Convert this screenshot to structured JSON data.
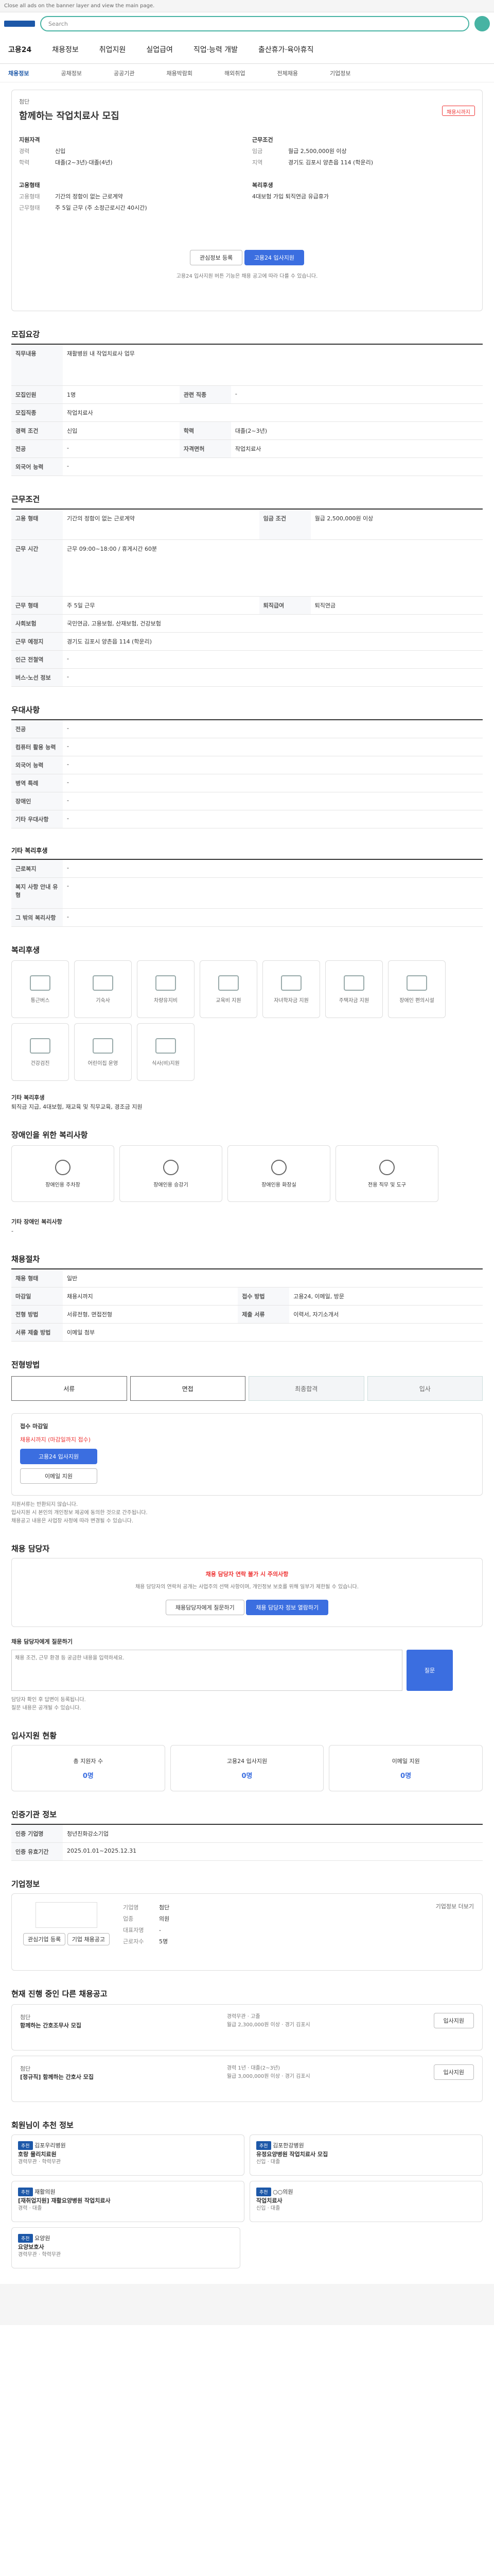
{
  "top": {
    "notice": "Close all ads on the banner layer and view the main page.",
    "search_placeholder": "Search"
  },
  "gnb": {
    "logo": "고용24",
    "menu": [
      "채용정보",
      "취업지원",
      "실업급여",
      "직업·능력 개발",
      "출산휴가·육아휴직"
    ]
  },
  "subnav": [
    "채용정보",
    "공채정보",
    "공공기관",
    "채용박람회",
    "해외취업",
    "전체채용",
    "기업정보"
  ],
  "job": {
    "company": "첨단",
    "title": "함께하는 작업치료사 모집",
    "badge": "채용시까지",
    "reqs": [
      [
        "지원자격",
        ""
      ],
      [
        "경력",
        "신입"
      ],
      [
        "학력",
        "대졸(2~3년)·대졸(4년)"
      ]
    ],
    "conds": [
      [
        "근무조건",
        ""
      ],
      [
        "임금",
        "월급 2,500,000원 이상"
      ],
      [
        "지역",
        "경기도 김포시 양촌읍 114 (학운리)"
      ]
    ],
    "env": [
      [
        "고용형태",
        ""
      ],
      [
        "고용형태",
        "기간의 정함이 없는 근로계약"
      ],
      [
        "근무형태",
        "주 5일 근무 (주 소정근로시간 40시간)"
      ]
    ],
    "benefit": [
      [
        "복리후생",
        ""
      ],
      [
        "",
        "4대보험 가입   퇴직연금   유급휴가"
      ]
    ],
    "scrap": "관심정보 등록",
    "apply": "고용24 입사지원",
    "notice": "고용24 입사지원 버튼 기능은 채용 공고에 따라 다를 수 있습니다."
  },
  "s1": {
    "title": "모집요강",
    "rows": [
      [
        "직무내용",
        "재활병원 내 작업치료사 업무"
      ],
      [
        "모집직종",
        "작업치료사"
      ],
      [
        "관련 직종",
        "-"
      ],
      [
        "모집인원",
        "1명"
      ],
      [
        "경력 조건",
        "신입"
      ],
      [
        "학력",
        "대졸(2~3년)"
      ],
      [
        "전공",
        "-"
      ],
      [
        "자격면허",
        "작업치료사"
      ],
      [
        "외국어 능력",
        "-"
      ]
    ]
  },
  "s2": {
    "title": "근무조건",
    "rows": [
      [
        "고용 형태",
        "기간의 정함이 없는 근로계약"
      ],
      [
        "임금 조건",
        "월급 2,500,000원 이상"
      ],
      [
        "근무 시간",
        "근무 09:00~18:00 / 휴게시간 60분"
      ],
      [
        "근무 형태",
        "주 5일 근무"
      ],
      [
        "사회보험",
        "국민연금, 고용보험, 산재보험, 건강보험"
      ],
      [
        "퇴직급여",
        "퇴직연금"
      ],
      [
        "근무 예정지",
        "경기도 김포시 양촌읍 114 (학운리)"
      ],
      [
        "인근 전철역",
        "-"
      ],
      [
        "버스·노선 정보",
        "-"
      ]
    ]
  },
  "s3": {
    "title": "우대사항",
    "rows": [
      [
        "전공",
        "-"
      ],
      [
        "컴퓨터 활용 능력",
        "-"
      ],
      [
        "외국어 능력",
        "-"
      ],
      [
        "병역 특례",
        "-"
      ],
      [
        "장애인",
        "-"
      ],
      [
        "기타 우대사항",
        "-"
      ]
    ],
    "sub_title": "기타 복리후생",
    "rows2": [
      [
        "근로복지",
        "-"
      ],
      [
        "복지 사항 안내 유형",
        "-"
      ],
      [
        "그 밖의 복리사항",
        "-"
      ]
    ]
  },
  "s4": {
    "title": "복리후생",
    "items": [
      "통근버스",
      "기숙사",
      "차량유지비",
      "교육비 지원",
      "자녀학자금 지원",
      "주택자금 지원",
      "장애인 편의시설",
      "건강검진",
      "어린이집 운영",
      "식사(비)지원"
    ],
    "other_title": "기타 복리후생",
    "other": "퇴직금 지급, 4대보험, 재교육 및 직무교육, 경조금 지원"
  },
  "s5": {
    "title": "장애인을 위한 복리사항",
    "items": [
      "장애인용 주차장",
      "장애인용 승강기",
      "장애인용 화장실",
      "전용 직무 및 도구"
    ],
    "other_title": "기타 장애인 복리사항",
    "other": "-"
  },
  "s6": {
    "title": "채용절차",
    "rows": [
      [
        "채용 형태",
        "일반"
      ],
      [
        "마감일",
        "채용시까지"
      ],
      [
        "접수 방법",
        "고용24, 이메일, 방문"
      ],
      [
        "전형 방법",
        "서류전형, 면접전형"
      ],
      [
        "제출 서류",
        "이력서, 자기소개서"
      ],
      [
        "서류 제출 방법",
        "이메일 첨부"
      ]
    ]
  },
  "s7": {
    "title": "전형방법",
    "steps": [
      "서류",
      "면접",
      "최종합격",
      "입사"
    ],
    "doc_title": "접수 마감일",
    "doc": "채용시까지 (마감일까지 접수)",
    "apply": "고용24 입사지원",
    "email": "이메일 지원",
    "notes": [
      "지원서류는 반환되지 않습니다.",
      "입사지원 시 본인의 개인정보 제공에 동의한 것으로 간주됩니다.",
      "채용공고 내용은 사업장 사정에 따라 변경될 수 있습니다."
    ]
  },
  "s8": {
    "title": "채용 담당자",
    "warn": "채용 담당자 연락 불가 시 주의사항",
    "warn_text": "채용 담당자의 연락처 공개는 사업주의 선택 사항이며, 개인정보 보호를 위해 일부가 제한될 수 있습니다.",
    "b1": "채용담당자에게 질문하기",
    "b2": "채용 담당자 정보 열람하기",
    "qa_title": "채용 담당자에게 질문하기",
    "qa_placeholder": "채용 조건, 근무 환경 등 궁금한 내용을 입력하세요.",
    "qa_btn": "질문",
    "notes": [
      "담당자 확인 후 답변이 등록됩니다.",
      "질문 내용은 공개될 수 있습니다."
    ]
  },
  "s9": {
    "title": "입사지원 현황",
    "stats": [
      [
        "총 지원자 수",
        "0명"
      ],
      [
        "고용24 입사지원",
        "0명"
      ],
      [
        "이메일 지원",
        "0명"
      ]
    ]
  },
  "s10": {
    "title": "인증기관 정보",
    "rows": [
      [
        "인증 기업명",
        "청년친화강소기업"
      ],
      [
        "인증 유효기간",
        "2025.01.01~2025.12.31"
      ]
    ]
  },
  "s11": {
    "title": "기업정보",
    "company": "첨단",
    "info": [
      [
        "기업명",
        "첨단"
      ],
      [
        "업종",
        "의원"
      ],
      [
        "대표자명",
        "-"
      ],
      [
        "근로자수",
        "5명"
      ]
    ],
    "more": "기업정보 더보기",
    "b1": "관심기업 등록",
    "b2": "기업 채용공고"
  },
  "s12": {
    "title": "현재 진행 중인 다른 채용공고",
    "jobs": [
      {
        "company": "첨단",
        "title": "함께하는 간호조무사 모집",
        "c1": "경력무관",
        "c2": "고졸",
        "c3": "월급 2,300,000원 이상",
        "c4": "경기 김포시"
      },
      {
        "company": "첨단",
        "title": "[정규직] 함께하는 간호사 모집",
        "c1": "경력 1년",
        "c2": "대졸(2~3년)",
        "c3": "월급 3,000,000원 이상",
        "c4": "경기 김포시"
      }
    ],
    "btn": "입사지원"
  },
  "s13": {
    "title": "회원님이 추천 정보",
    "recs": [
      {
        "tag": "추천",
        "company": "김포우리병원",
        "title": "호랑 물리치료원",
        "sub": "경력무관 · 학력무관"
      },
      {
        "tag": "추천",
        "company": "김포한강병원",
        "title": "유정요양병원 작업치료사 모집",
        "sub": "신입 · 대졸"
      },
      {
        "tag": "추천",
        "company": "재활의원",
        "title": "[재취업지원] 재활요양병원 작업치료사",
        "sub": "경력 · 대졸"
      },
      {
        "tag": "추천",
        "company": "○○의원",
        "title": "작업치료사",
        "sub": "신입 · 대졸"
      },
      {
        "tag": "추천",
        "company": "요양원",
        "title": "요양보호사",
        "sub": "경력무관 · 학력무관"
      }
    ]
  }
}
